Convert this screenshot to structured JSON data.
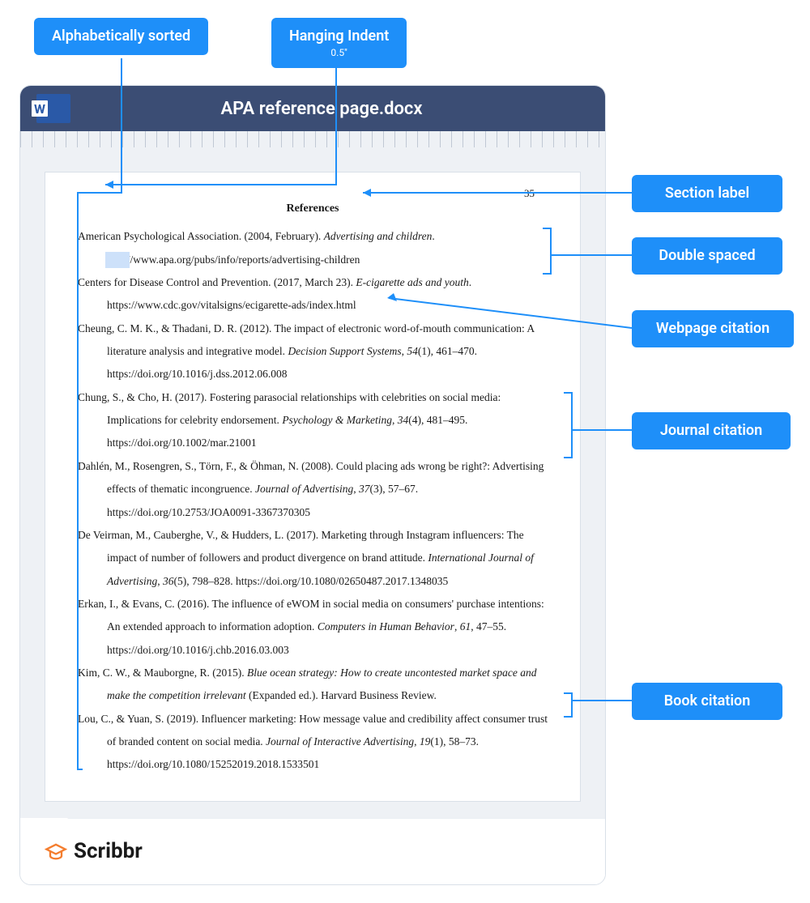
{
  "labels": {
    "top1": "Alphabetically sorted",
    "top2": "Hanging Indent",
    "top2_sub": "0.5\"",
    "side1": "Section label",
    "side2": "Double spaced",
    "side3": "Webpage citation",
    "side4": "Journal citation",
    "side5": "Book citation"
  },
  "doc": {
    "filename": "APA reference page.docx",
    "page_num": "35",
    "ref_heading": "References"
  },
  "refs": {
    "r1a": "American Psychological Association. (2004, February). ",
    "r1i": "Advertising and children",
    "r1b": ". http://www.apa.org/pubs/info/reports/advertising-children",
    "r2a": "Centers for Disease Control and Prevention. (2017, March 23). ",
    "r2i": "E-cigarette ads and youth",
    "r2b": ". https://www.cdc.gov/vitalsigns/ecigarette-ads/index.html",
    "r3a": "Cheung, C. M. K., & Thadani, D. R. (2012). The impact of electronic word-of-mouth communication: A literature analysis and integrative model. ",
    "r3i": "Decision Support Systems",
    "r3b": ", ",
    "r3i2": "54",
    "r3c": "(1), 461–470. https://doi.org/10.1016/j.dss.2012.06.008",
    "r4a": "Chung, S., & Cho, H. (2017). Fostering parasocial relationships with celebrities on social media: Implications for celebrity endorsement. ",
    "r4i": "Psychology & Marketing",
    "r4b": ", ",
    "r4i2": "34",
    "r4c": "(4), 481–495. https://doi.org/10.1002/mar.21001",
    "r5a": "Dahlén, M., Rosengren, S., Törn, F., & Öhman, N. (2008). Could placing ads wrong be right?: Advertising effects of thematic incongruence. ",
    "r5i": "Journal of Advertising",
    "r5b": ", ",
    "r5i2": "37",
    "r5c": "(3), 57–67. https://doi.org/10.2753/JOA0091-3367370305",
    "r6a": "De Veirman, M., Cauberghe, V., & Hudders, L. (2017). Marketing through Instagram influencers: The impact of number of followers and product divergence on brand attitude. ",
    "r6i": "International Journal of Advertising",
    "r6b": ", ",
    "r6i2": "36",
    "r6c": "(5), 798–828. https://doi.org/10.1080/02650487.2017.1348035",
    "r7a": "Erkan, I., & Evans, C. (2016). The influence of eWOM in social media on consumers' purchase intentions: An extended approach to information adoption. ",
    "r7i": "Computers in Human Behavior",
    "r7b": ", ",
    "r7i2": "61",
    "r7c": ", 47–55. https://doi.org/10.1016/j.chb.2016.03.003",
    "r8a": "Kim, C. W., & Mauborgne, R. (2015). ",
    "r8i": "Blue ocean strategy: How to create uncontested market space and make the competition irrelevant",
    "r8b": " (Expanded ed.). Harvard Business Review.",
    "r9a": "Lou, C., & Yuan, S. (2019). Influencer marketing: How message value and credibility affect consumer trust of branded content on social media. ",
    "r9i": "Journal of Interactive Advertising",
    "r9b": ", ",
    "r9i2": "19",
    "r9c": "(1), 58–73. https://doi.org/10.1080/15252019.2018.1533501"
  },
  "brand": "Scribbr"
}
